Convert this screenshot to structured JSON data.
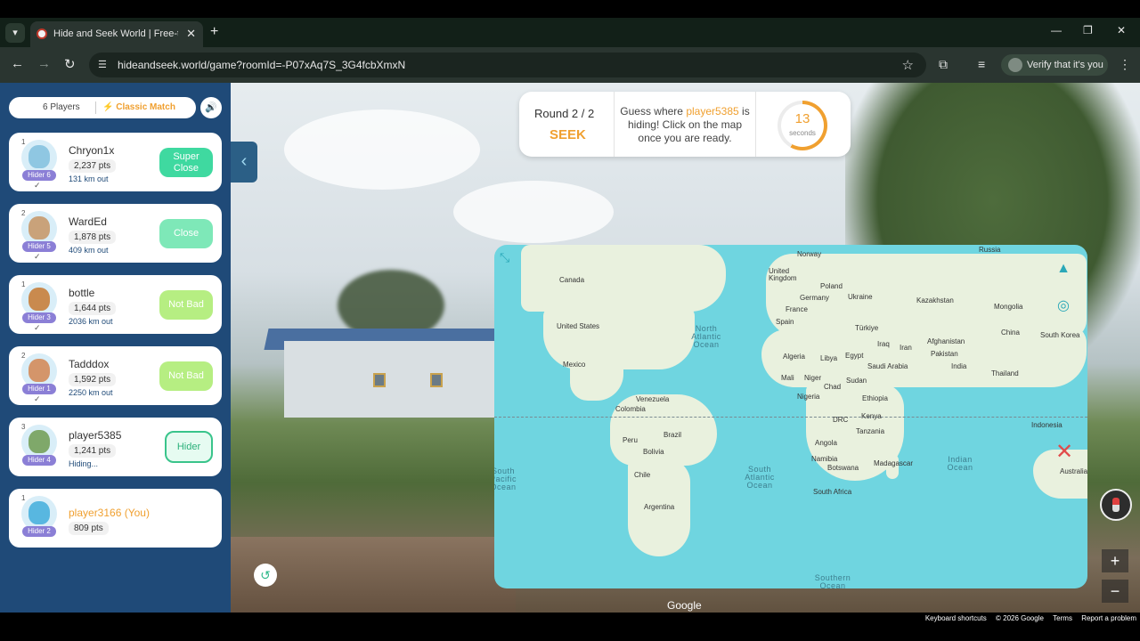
{
  "browser": {
    "tab_title": "Hide and Seek World | Free-to-",
    "tab_close": "✕",
    "new_tab": "+",
    "url": "hideandseek.world/game?roomId=-P07xAq7S_3G4fcbXmxN",
    "verify_label": "Verify that it's you"
  },
  "sidebar": {
    "player_count": "6 Players",
    "match_type": "Classic Match",
    "players": [
      {
        "rank": "1",
        "name": "Chryon1x",
        "points": "2,237 pts",
        "distance": "131 km out",
        "hider": "Hider 6",
        "status": "Super Close",
        "status_line1": "Super",
        "status_line2": "Close"
      },
      {
        "rank": "2",
        "name": "WardEd",
        "points": "1,878 pts",
        "distance": "409 km out",
        "hider": "Hider 5",
        "status": "Close"
      },
      {
        "rank": "1",
        "name": "bottle",
        "points": "1,644 pts",
        "distance": "2036 km out",
        "hider": "Hider 3",
        "status": "Not Bad"
      },
      {
        "rank": "2",
        "name": "Tadddox",
        "points": "1,592 pts",
        "distance": "2250 km out",
        "hider": "Hider 1",
        "status": "Not Bad"
      },
      {
        "rank": "3",
        "name": "player5385",
        "points": "1,241 pts",
        "distance": "Hiding...",
        "hider": "Hider 4",
        "status": "Hider"
      },
      {
        "rank": "1",
        "name": "player3166 (You)",
        "points": "809 pts",
        "hider": "Hider 2"
      }
    ]
  },
  "round_panel": {
    "round": "Round 2 / 2",
    "mode": "SEEK",
    "guess_prefix": "Guess where ",
    "guess_player": "player5385",
    "guess_suffix": " is hiding! Click on the map once you are ready.",
    "timer_value": "13",
    "timer_unit": "seconds",
    "timer_fraction": 0.58
  },
  "map": {
    "countries": [
      "Russia",
      "Norway",
      "United Kingdom",
      "Poland",
      "Germany",
      "Ukraine",
      "Kazakhstan",
      "France",
      "Mongolia",
      "Spain",
      "Türkiye",
      "China",
      "South Korea",
      "Canada",
      "United States",
      "Iraq",
      "Iran",
      "Afghanistan",
      "Pakistan",
      "Algeria",
      "Libya",
      "Egypt",
      "Saudi Arabia",
      "India",
      "Mexico",
      "Mali",
      "Niger",
      "Chad",
      "Sudan",
      "Thailand",
      "Venezuela",
      "Colombia",
      "Nigeria",
      "Ethiopia",
      "Kenya",
      "DRC",
      "Tanzania",
      "Indonesia",
      "Peru",
      "Brazil",
      "Angola",
      "Bolivia",
      "Namibia",
      "Botswana",
      "Madagascar",
      "Chile",
      "South Africa",
      "Argentina",
      "Australia"
    ],
    "oceans": {
      "north_atlantic": "North Atlantic Ocean",
      "south_atlantic": "South Atlantic Ocean",
      "indian": "Indian Ocean",
      "south_pacific": "South Pacific Ocean",
      "southern": "Southern Ocean"
    }
  },
  "footer": {
    "google": "Google",
    "shortcuts": "Keyboard shortcuts",
    "copyright": "© 2026 Google",
    "terms": "Terms",
    "report": "Report a problem"
  },
  "colors": {
    "sidebar_bg": "#1f4a78",
    "accent": "#f0a030",
    "super_close": "#3fd9a0",
    "close": "#7ee8b8",
    "not_bad": "#b6ee82",
    "map_water": "#6fd5e0"
  }
}
